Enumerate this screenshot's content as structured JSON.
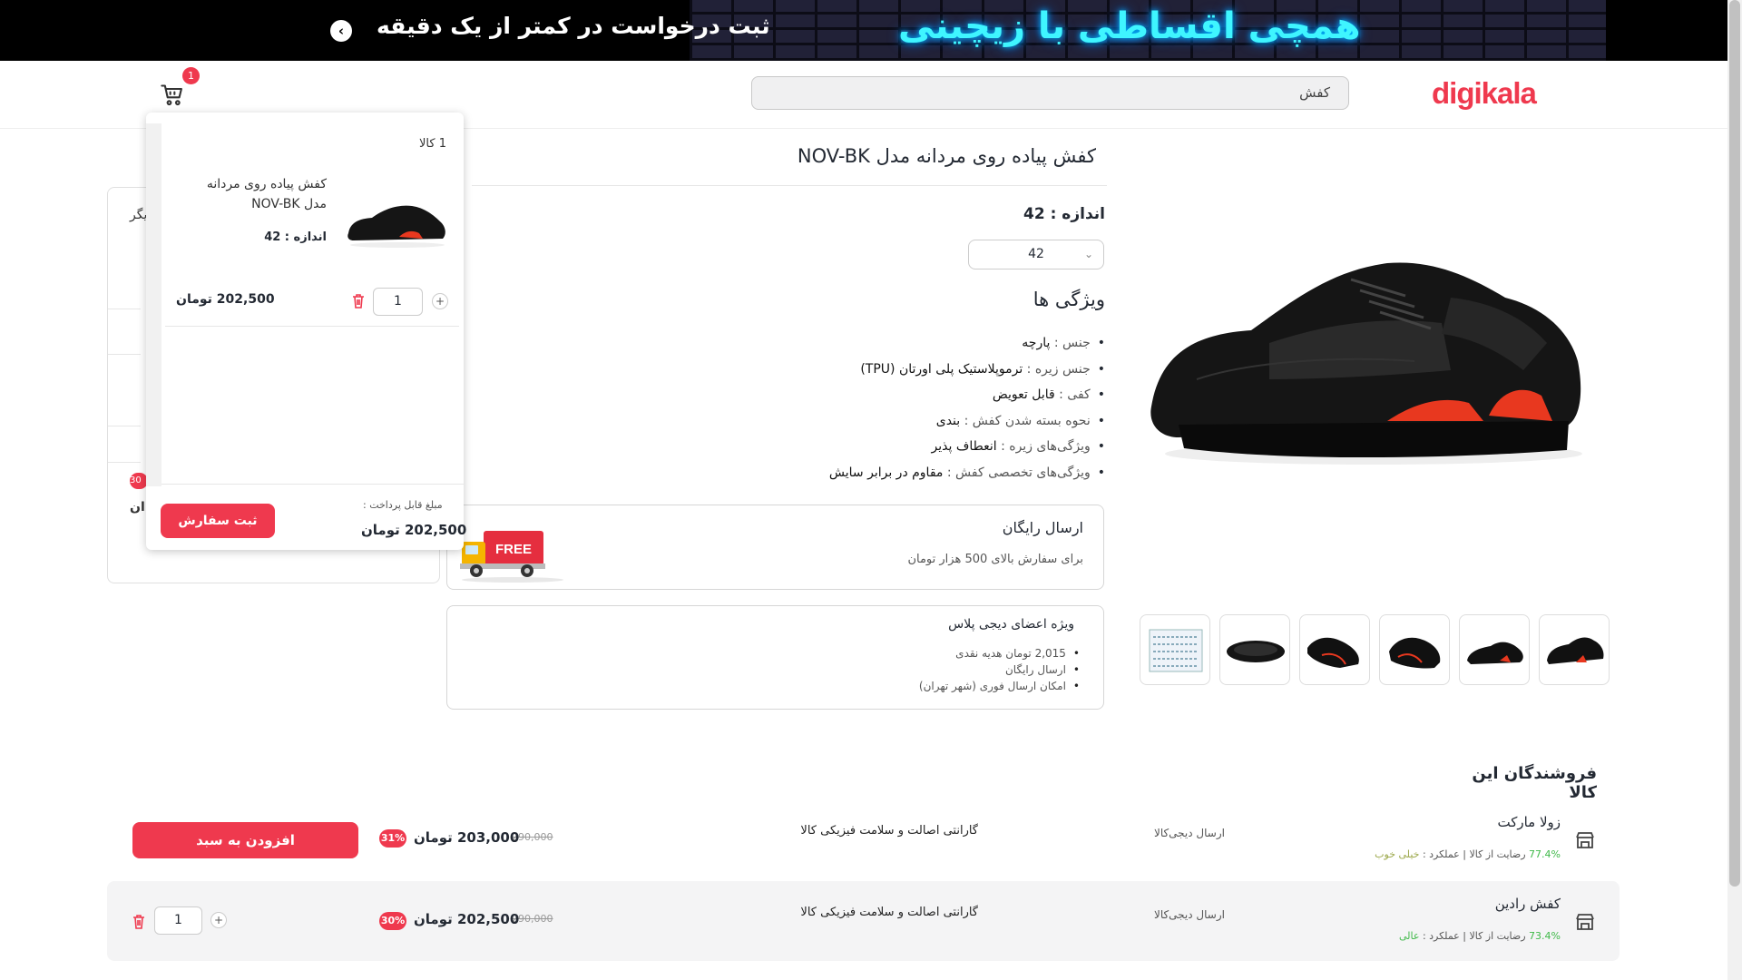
{
  "banner": {
    "neon_text": "همچی اقساطی با زیچینی",
    "text": "ثبت درخواست در کمتر از یک دقیقه",
    "arrow": "‹"
  },
  "header": {
    "logo": "digikala",
    "search_value": "کفش",
    "cart_count": "1"
  },
  "product": {
    "title": "کفش پیاده روی مردانه مدل NOV-BK",
    "size_label": "اندازه : 42",
    "size_selected": "42",
    "features_title": "ویژگی ها",
    "features": [
      {
        "key": "جنس :",
        "value": "پارچه"
      },
      {
        "key": "جنس زیره :",
        "value": "ترموپلاستیک پلی اورتان (TPU)"
      },
      {
        "key": "کفی :",
        "value": "قابل تعویض"
      },
      {
        "key": "نحوه بسته شدن کفش :",
        "value": "بندی"
      },
      {
        "key": "ویژگی‌های زیره :",
        "value": "انعطاف پذیر"
      },
      {
        "key": "ویژگی‌های تخصصی کفش :",
        "value": "مقاوم در برابر سایش"
      }
    ],
    "shipping_title": "ارسال رایگان",
    "shipping_sub": "برای سفارش بالای 500 هزار تومان",
    "truck_label": "FREE",
    "plus_title": "ویژه اعضای دیجی پلاس",
    "plus_items": [
      "2,015 تومان هدیه نقدی",
      "ارسال رایگان",
      "امکان ارسال فوری (شهر تهران)"
    ]
  },
  "cart_dropdown": {
    "count_label": "1 کالا",
    "item_name": "کفش پیاده روی مردانه مدل NOV-BK",
    "item_size": "اندازه : 42",
    "item_price": "202,500 تومان",
    "item_qty": "1",
    "pay_label": "مبلغ قابل پرداخت :",
    "pay_total": "202,500 تومان",
    "order_button": "ثبت سفارش"
  },
  "left_panel": {
    "partial_title": "یگر",
    "partial_badge": "30",
    "partial_price": "ان"
  },
  "sellers": {
    "title": "فروشندگان این کالا",
    "rows": [
      {
        "name": "زولا مارکت",
        "satisfaction": "77.4%",
        "satisfaction_label": "رضایت از کالا",
        "performance_label": "عملکرد :",
        "performance": "خیلی خوب",
        "shipping": "ارسال دیجی‌کالا",
        "warranty": "گارانتی اصالت و سلامت فیزیکی کالا",
        "old_price": "290,000",
        "price": "203,000 تومان",
        "discount": "31%",
        "action": "افزودن به سبد"
      },
      {
        "name": "کفش رادین",
        "satisfaction": "73.4%",
        "satisfaction_label": "رضایت از کالا",
        "performance_label": "عملکرد :",
        "performance": "عالی",
        "shipping": "ارسال دیجی‌کالا",
        "warranty": "گارانتی اصالت و سلامت فیزیکی کالا",
        "old_price": "290,000",
        "price": "202,500 تومان",
        "discount": "30%",
        "qty": "1"
      }
    ]
  },
  "icons": [
    "cart-icon",
    "trash-icon",
    "plus-icon",
    "store-icon",
    "chevron-down-icon",
    "arrow-left-icon"
  ],
  "colors": {
    "brand": "#ef394e",
    "banner_bg": "#000000",
    "neon": "#3ff5ff",
    "success": "#3fb949"
  }
}
